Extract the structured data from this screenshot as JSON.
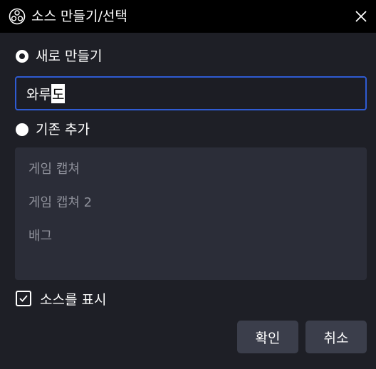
{
  "window": {
    "title": "소스 만들기/선택",
    "logo_icon": "obs-logo-icon",
    "close_icon": "close-icon"
  },
  "create_new": {
    "label": "새로 만들기",
    "selected": true,
    "name_value_committed": "와루",
    "name_value_composing": "도"
  },
  "add_existing": {
    "label": "기존 추가",
    "selected": false,
    "sources": [
      "게임 캡쳐",
      "게임 캡쳐 2",
      "배그"
    ]
  },
  "make_visible": {
    "label": "소스를 표시",
    "checked": true
  },
  "buttons": {
    "ok_label": "확인",
    "cancel_label": "취소"
  },
  "colors": {
    "background": "#1e1f26",
    "titlebar": "#000000",
    "accent_border": "#2f5bd2",
    "list_background": "#2b2d38",
    "button_background": "#3b3e4b",
    "list_text": "#8d8f99"
  }
}
